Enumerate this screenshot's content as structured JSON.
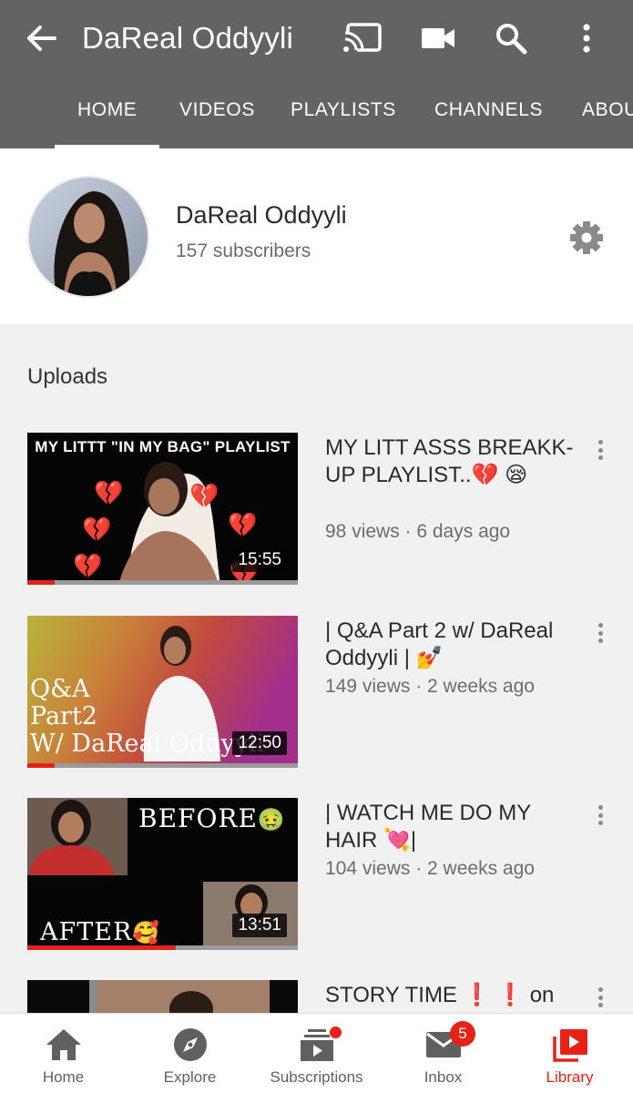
{
  "header": {
    "title": "DaReal Oddyyli",
    "tabs": [
      "HOME",
      "VIDEOS",
      "PLAYLISTS",
      "CHANNELS",
      "ABOU"
    ],
    "active_tab": "HOME"
  },
  "channel": {
    "name": "DaReal Oddyyli",
    "subscribers": "157 subscribers"
  },
  "uploads": {
    "heading": "Uploads",
    "videos": [
      {
        "title": "MY LITT ASSS BREAKK-UP PLAYLIST..💔 😪",
        "meta": "98 views · 6 days ago",
        "duration": "15:55",
        "thumb_text": "MY LITTT \"IN MY BAG\" PLAYLIST",
        "watched_fraction": 0.1
      },
      {
        "title": "| Q&A Part 2 w/ DaReal Oddyyli | 💅",
        "meta": "149 views · 2 weeks ago",
        "duration": "12:50",
        "thumb_text_1": "Q&A",
        "thumb_text_2": "Part2",
        "thumb_text_3": "W/ DaReal Oddyyli",
        "watched_fraction": 0.1
      },
      {
        "title": "| WATCH ME DO MY HAIR 💘|",
        "meta": "104 views · 2 weeks ago",
        "duration": "13:51",
        "thumb_text_before": "BEFORE",
        "thumb_text_after": "AFTER",
        "watched_fraction": 0.55
      },
      {
        "title": "STORY TIME ❗ ❗ on"
      }
    ]
  },
  "bottom_nav": {
    "items": [
      "Home",
      "Explore",
      "Subscriptions",
      "Inbox",
      "Library"
    ],
    "active": "Library",
    "inbox_badge": "5"
  },
  "colors": {
    "header_bg": "#636363",
    "accent_red": "#e62117"
  }
}
